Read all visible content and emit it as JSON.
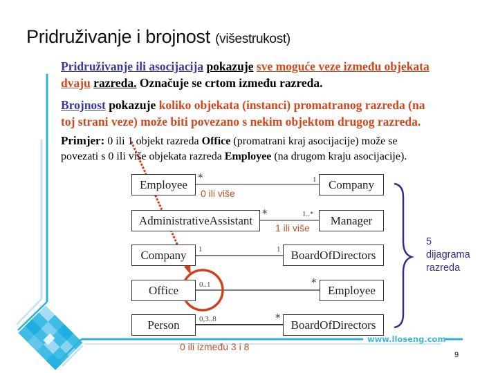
{
  "slide": {
    "title_main": "Pridruživanje i brojnost",
    "title_sub": "(višestrukost)",
    "paragraph1": {
      "term": "Pridruživanje ili asocijacija",
      "verb": "pokazuje",
      "highlight": "sve moguće veze između objekata",
      "line2_highlight": "dvaju",
      "line2_underlined": "razreda.",
      "line2_rest": "Označuje se crtom između razreda."
    },
    "paragraph2": {
      "term": "Brojnost",
      "verb": "pokazuje",
      "highlight_line1": "koliko objekata (instanci) promatranog razreda (na",
      "highlight_line2": "toj strani veze)  može biti povezano s nekim objektom drugog razreda."
    },
    "paragraph3": {
      "lead": "Primjer:",
      "text1": "0 ili 1 objekt razreda",
      "class1": "Office",
      "text2": "(promatrani kraj asocijacije) može se",
      "text3": "povezati s 0 ili više objekata razreda",
      "class2": "Employee",
      "text4": "(na drugom kraju asocijacije)."
    },
    "diagrams": [
      {
        "left": "Employee",
        "left_mult": "*",
        "right": "Company",
        "right_mult": "1",
        "note": "0 ili više"
      },
      {
        "left": "AdministrativeAssistant",
        "left_mult": "*",
        "right": "Manager",
        "right_mult": "1..*",
        "note": "1 ili više"
      },
      {
        "left": "Company",
        "left_mult": "1",
        "right": "BoardOfDirectors",
        "right_mult": "1",
        "note": ""
      },
      {
        "left": "Office",
        "left_mult": "0..1",
        "right": "Employee",
        "right_mult": "*",
        "note": ""
      },
      {
        "left": "Person",
        "left_mult": "0,3..8",
        "right": "BoardOfDirectors",
        "right_mult": "*",
        "note": "0 ili između 3 i 8"
      }
    ],
    "brace_label": [
      "5",
      "dijagrama",
      "razreda"
    ],
    "website": "www.lloseng.com",
    "page_number": "9",
    "colors": {
      "term_blue": "#3a3aa0",
      "highlight_orange": "#d2481e",
      "annotation_red": "#d2401e",
      "brace_blue": "#2f2f8f",
      "decor_cyan": "#2bb3d4"
    }
  }
}
